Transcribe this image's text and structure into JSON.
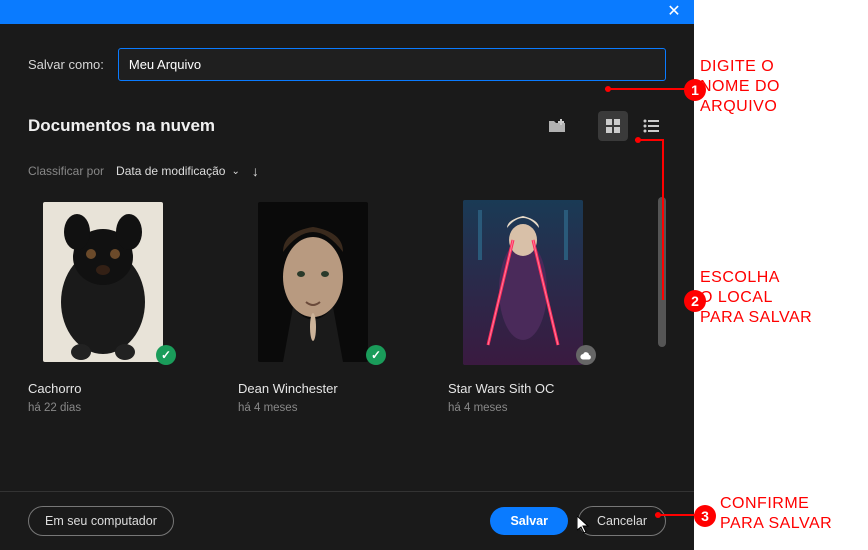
{
  "titlebar": {
    "close_glyph": "✕"
  },
  "saveas": {
    "label": "Salvar como:",
    "value": "Meu Arquivo"
  },
  "section": {
    "title": "Documentos na nuvem"
  },
  "sort": {
    "label": "Classificar por",
    "value": "Data de modificação"
  },
  "files": [
    {
      "title": "Cachorro",
      "time": "há 22 dias",
      "badge": "synced"
    },
    {
      "title": "Dean Winchester",
      "time": "há 4 meses",
      "badge": "synced"
    },
    {
      "title": "Star Wars Sith OC",
      "time": "há 4 meses",
      "badge": "cloud"
    }
  ],
  "footer": {
    "on_computer": "Em seu computador",
    "save": "Salvar",
    "cancel": "Cancelar"
  },
  "annotations": {
    "a1": {
      "text": "DIGITE O\nNOME DO\nARQUIVO"
    },
    "a2": {
      "text": "ESCOLHA\nO LOCAL\nPARA SALVAR"
    },
    "a3": {
      "text": "CONFIRME\nPARA SALVAR"
    }
  },
  "colors": {
    "accent": "#0a7bff",
    "anno": "#ff0000"
  }
}
